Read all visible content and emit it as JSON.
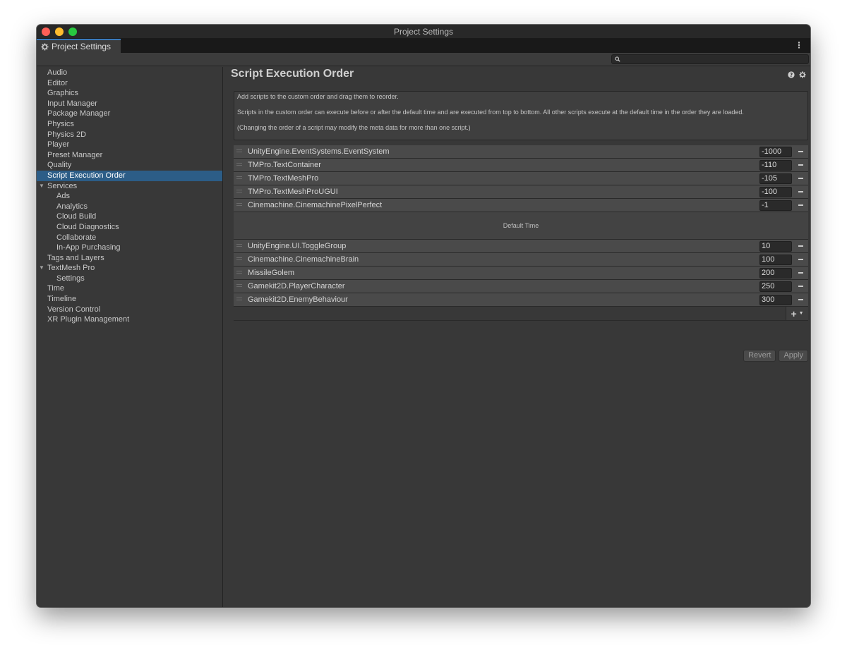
{
  "window": {
    "title": "Project Settings"
  },
  "tab": {
    "label": "Project Settings"
  },
  "search": {
    "placeholder": ""
  },
  "sidebar": {
    "items": [
      {
        "label": "Audio",
        "level": 0
      },
      {
        "label": "Editor",
        "level": 0
      },
      {
        "label": "Graphics",
        "level": 0
      },
      {
        "label": "Input Manager",
        "level": 0
      },
      {
        "label": "Package Manager",
        "level": 0
      },
      {
        "label": "Physics",
        "level": 0
      },
      {
        "label": "Physics 2D",
        "level": 0
      },
      {
        "label": "Player",
        "level": 0
      },
      {
        "label": "Preset Manager",
        "level": 0
      },
      {
        "label": "Quality",
        "level": 0
      },
      {
        "label": "Script Execution Order",
        "level": 0,
        "selected": true
      },
      {
        "label": "Services",
        "level": 0,
        "expanded": true
      },
      {
        "label": "Ads",
        "level": 1
      },
      {
        "label": "Analytics",
        "level": 1
      },
      {
        "label": "Cloud Build",
        "level": 1
      },
      {
        "label": "Cloud Diagnostics",
        "level": 1
      },
      {
        "label": "Collaborate",
        "level": 1
      },
      {
        "label": "In-App Purchasing",
        "level": 1
      },
      {
        "label": "Tags and Layers",
        "level": 0
      },
      {
        "label": "TextMesh Pro",
        "level": 0,
        "expanded": true
      },
      {
        "label": "Settings",
        "level": 1
      },
      {
        "label": "Time",
        "level": 0
      },
      {
        "label": "Timeline",
        "level": 0
      },
      {
        "label": "Version Control",
        "level": 0
      },
      {
        "label": "XR Plugin Management",
        "level": 0
      }
    ]
  },
  "main": {
    "title": "Script Execution Order",
    "help": {
      "line1": "Add scripts to the custom order and drag them to reorder.",
      "line2": "Scripts in the custom order can execute before or after the default time and are executed from top to bottom. All other scripts execute at the default time in the order they are loaded.",
      "line3": "(Changing the order of a script may modify the meta data for more than one script.)"
    },
    "before": [
      {
        "name": "UnityEngine.EventSystems.EventSystem",
        "value": "-1000"
      },
      {
        "name": "TMPro.TextContainer",
        "value": "-110"
      },
      {
        "name": "TMPro.TextMeshPro",
        "value": "-105"
      },
      {
        "name": "TMPro.TextMeshProUGUI",
        "value": "-100"
      },
      {
        "name": "Cinemachine.CinemachinePixelPerfect",
        "value": "-1"
      }
    ],
    "default_time": "Default Time",
    "after": [
      {
        "name": "UnityEngine.UI.ToggleGroup",
        "value": "10"
      },
      {
        "name": "Cinemachine.CinemachineBrain",
        "value": "100"
      },
      {
        "name": "MissileGolem",
        "value": "200"
      },
      {
        "name": "Gamekit2D.PlayerCharacter",
        "value": "250"
      },
      {
        "name": "Gamekit2D.EnemyBehaviour",
        "value": "300"
      }
    ],
    "revert_label": "Revert",
    "apply_label": "Apply"
  },
  "icons": {
    "tab": "gear-icon",
    "menu": "kebab-menu-icon",
    "search": "search-icon",
    "help": "help-icon",
    "settings": "gear-icon",
    "add": "plus-icon",
    "remove": "minus-icon"
  },
  "colors": {
    "selection": "#2c5d87",
    "tab_accent": "#3a79bb"
  }
}
